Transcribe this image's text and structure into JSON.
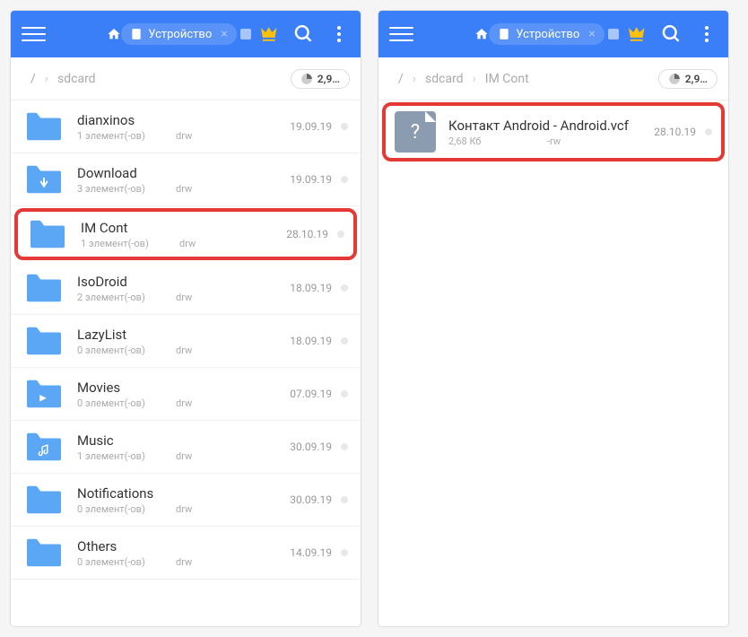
{
  "topbar": {
    "chip_label": "Устройство"
  },
  "left": {
    "breadcrumb": [
      "/",
      "sdcard"
    ],
    "storage": "2,9…",
    "items": [
      {
        "name": "dianxinos",
        "size": "1 элемент(-ов)",
        "perm": "drw",
        "date": "19.09.19",
        "icon": "folder"
      },
      {
        "name": "Download",
        "size": "3 элемент(-ов)",
        "perm": "drw",
        "date": "19.09.19",
        "icon": "download"
      },
      {
        "name": "IM Cont",
        "size": "1 элемент(-ов)",
        "perm": "drw",
        "date": "28.10.19",
        "icon": "folder",
        "highlight": true
      },
      {
        "name": "IsoDroid",
        "size": "2 элемент(-ов)",
        "perm": "drw",
        "date": "18.09.19",
        "icon": "folder"
      },
      {
        "name": "LazyList",
        "size": "0 элемент(-ов)",
        "perm": "drw",
        "date": "18.09.19",
        "icon": "folder"
      },
      {
        "name": "Movies",
        "size": "0 элемент(-ов)",
        "perm": "drw",
        "date": "07.09.19",
        "icon": "movies"
      },
      {
        "name": "Music",
        "size": "1 элемент(-ов)",
        "perm": "drw",
        "date": "30.09.19",
        "icon": "music"
      },
      {
        "name": "Notifications",
        "size": "0 элемент(-ов)",
        "perm": "drw",
        "date": "30.09.19",
        "icon": "folder"
      },
      {
        "name": "Others",
        "size": "0 элемент(-ов)",
        "perm": "drw",
        "date": "14.09.19",
        "icon": "folder"
      }
    ]
  },
  "right": {
    "breadcrumb": [
      "/",
      "sdcard",
      "IM Cont"
    ],
    "storage": "2,9…",
    "items": [
      {
        "name": "Контакт Android - Android.vcf",
        "size": "2,68 Кб",
        "perm": "-rw",
        "date": "28.10.19",
        "icon": "file",
        "highlight": true
      }
    ]
  }
}
